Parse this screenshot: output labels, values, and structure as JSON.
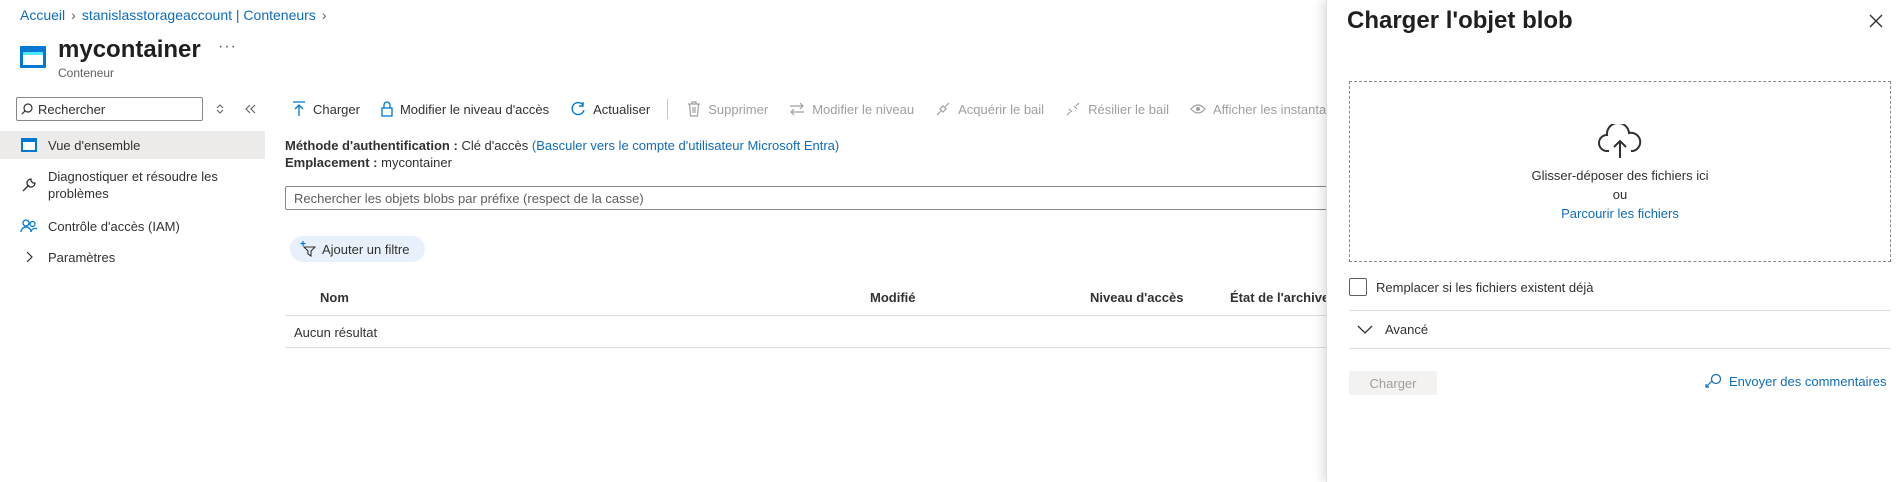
{
  "breadcrumb": [
    "Accueil",
    "stanislasstorageaccount | Conteneurs"
  ],
  "header": {
    "title": "mycontainer",
    "subtitle": "Conteneur",
    "more": "···"
  },
  "sidebar": {
    "search_placeholder": "Rechercher",
    "items": [
      {
        "label": "Vue d'ensemble",
        "icon": "container-icon",
        "active": true
      },
      {
        "label_line1": "Diagnostiquer et résoudre les",
        "label_line2": "problèmes",
        "icon": "wrench-icon"
      },
      {
        "label": "Contrôle d'accès (IAM)",
        "icon": "people-icon"
      },
      {
        "label": "Paramètres",
        "icon": "chevron-right-icon"
      }
    ]
  },
  "toolbar": {
    "upload": "Charger",
    "change_access": "Modifier le niveau d'accès",
    "refresh": "Actualiser",
    "delete": "Supprimer",
    "change_tier": "Modifier le niveau",
    "acquire_lease": "Acquérir le bail",
    "break_lease": "Résilier le bail",
    "show_snapshots": "Afficher les instantanés"
  },
  "meta": {
    "auth_label": "Méthode d'authentification :",
    "auth_value": "Clé d'accès",
    "auth_switch": "(Basculer vers le compte d'utilisateur Microsoft Entra)",
    "location_label": "Emplacement :",
    "location_value": "mycontainer"
  },
  "blob_search_placeholder": "Rechercher les objets blobs par préfixe (respect de la casse)",
  "filter_label": "Ajouter un filtre",
  "table": {
    "columns": [
      "Nom",
      "Modifié",
      "Niveau d'accès",
      "État de l'archive"
    ],
    "empty": "Aucun résultat"
  },
  "panel": {
    "title": "Charger l'objet blob",
    "drop_text": "Glisser-déposer des fichiers ici",
    "or": "ou",
    "browse": "Parcourir les fichiers",
    "overwrite": "Remplacer si les fichiers existent déjà",
    "advanced": "Avancé",
    "submit": "Charger",
    "feedback": "Envoyer des commentaires"
  },
  "colors": {
    "accent": "#0f6cbd",
    "disabled": "#a19f9d",
    "active_bg": "#edebe9"
  }
}
